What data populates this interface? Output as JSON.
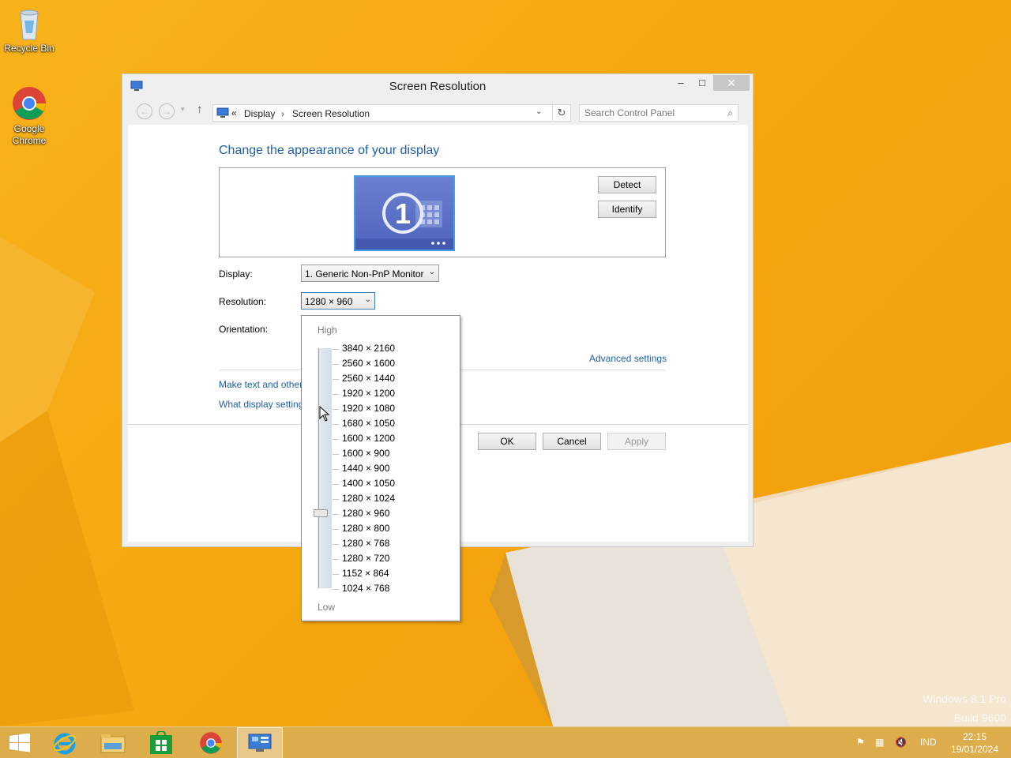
{
  "desktop": {
    "icons": [
      {
        "label": "Recycle Bin",
        "icon": "recycle-bin-icon"
      },
      {
        "label": "Google Chrome",
        "icon": "chrome-icon"
      }
    ],
    "watermark_line1": "Windows 8.1 Pro",
    "watermark_line2": "Build 9600"
  },
  "window": {
    "title": "Screen Resolution",
    "close_glyph": "✕",
    "min_glyph": "–",
    "max_glyph": "□",
    "breadcrumb": {
      "chevrons": "«",
      "items": [
        "Display",
        "Screen Resolution"
      ],
      "separator": "›"
    },
    "search_placeholder": "Search Control Panel",
    "heading": "Change the appearance of your display",
    "monitor_number": "1",
    "detect_label": "Detect",
    "identify_label": "Identify",
    "display_label": "Display:",
    "display_value": "1. Generic Non-PnP Monitor",
    "resolution_label": "Resolution:",
    "resolution_value": "1280 × 960",
    "orientation_label": "Orientation:",
    "advanced_settings": "Advanced settings",
    "link_text_size": "Make text and other",
    "link_what_settings": "What display setting",
    "ok_label": "OK",
    "cancel_label": "Cancel",
    "apply_label": "Apply"
  },
  "resolution_popup": {
    "high_label": "High",
    "low_label": "Low",
    "selected": "1280 × 960",
    "options": [
      "3840 × 2160",
      "2560 × 1600",
      "2560 × 1440",
      "1920 × 1200",
      "1920 × 1080",
      "1680 × 1050",
      "1600 × 1200",
      "1600 × 900",
      "1440 × 900",
      "1400 × 1050",
      "1280 × 1024",
      "1280 × 960",
      "1280 × 800",
      "1280 × 768",
      "1280 × 720",
      "1152 × 864",
      "1024 × 768"
    ]
  },
  "taskbar": {
    "apps": [
      "start-icon",
      "internet-explorer-icon",
      "file-explorer-icon",
      "store-icon",
      "chrome-icon",
      "control-panel-icon"
    ],
    "language": "IND",
    "time": "22:15",
    "date": "19/01/2024"
  },
  "colors": {
    "accent_link": "#1e5fa8",
    "wallpaper": "#f5a80f",
    "monitor_fill": "#5a6fc6"
  }
}
